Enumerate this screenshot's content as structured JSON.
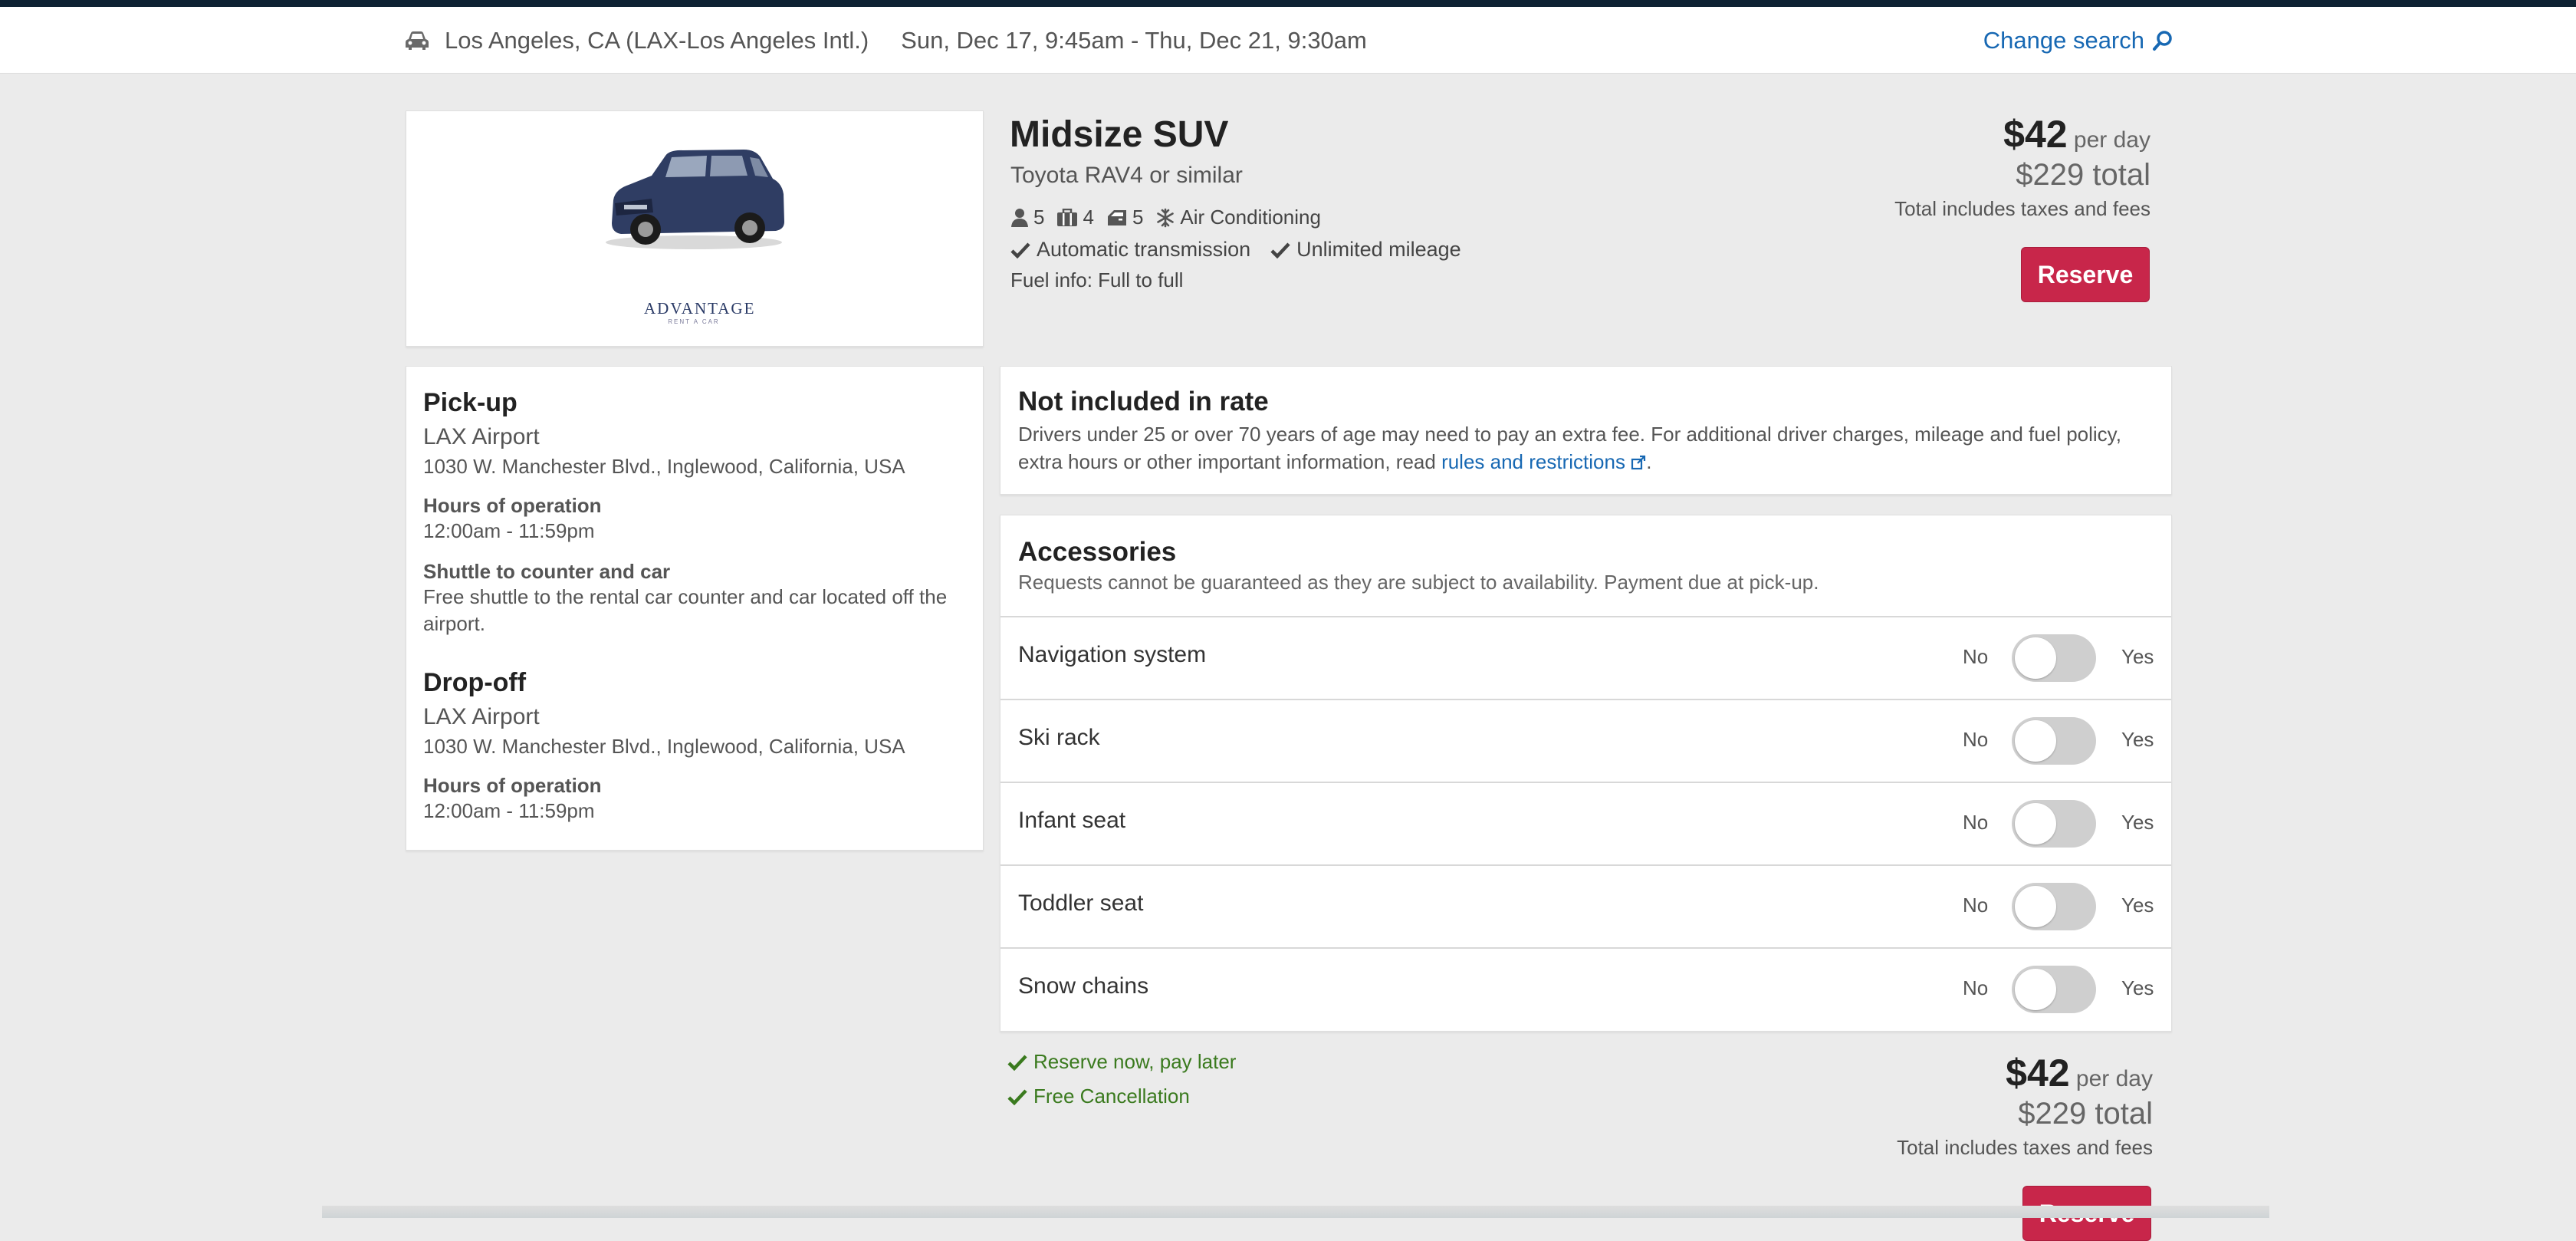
{
  "search": {
    "location": "Los Angeles, CA (LAX-Los Angeles Intl.)",
    "dates": "Sun, Dec 17, 9:45am - Thu, Dec 21, 9:30am",
    "change_label": "Change search"
  },
  "car": {
    "brand_logo": "ADVANTAGE",
    "brand_logo_sub": "RENT A CAR",
    "title": "Midsize SUV",
    "subtitle": "Toyota RAV4 or similar",
    "passengers": "5",
    "bags": "4",
    "doors": "5",
    "ac": "Air Conditioning",
    "transmission": "Automatic transmission",
    "mileage": "Unlimited mileage",
    "fuel": "Fuel info: Full to full"
  },
  "price": {
    "amount": "$42",
    "per": "per day",
    "total": "$229 total",
    "taxes": "Total includes taxes and fees",
    "reserve_label": "Reserve"
  },
  "pickup": {
    "heading": "Pick-up",
    "name": "LAX Airport",
    "address": "1030 W. Manchester Blvd., Inglewood, California, USA",
    "hours_label": "Hours of operation",
    "hours": "12:00am - 11:59pm",
    "shuttle_label": "Shuttle to counter and car",
    "shuttle_line1": "Free shuttle to the rental car counter and car located off the",
    "shuttle_line2": "airport."
  },
  "dropoff": {
    "heading": "Drop-off",
    "name": "LAX Airport",
    "address": "1030 W. Manchester Blvd., Inglewood, California, USA",
    "hours_label": "Hours of operation",
    "hours": "12:00am - 11:59pm"
  },
  "not_included": {
    "title": "Not included in rate",
    "body_line1": "Drivers under 25 or over 70 years of age may need to pay an extra fee. For additional driver charges, mileage and fuel policy,",
    "body_line2": "extra hours or other important information, read",
    "link": "rules and restrictions",
    "period": "."
  },
  "accessories": {
    "title": "Accessories",
    "description": "Requests cannot be guaranteed as they are subject to availability. Payment due at pick-up.",
    "no_label": "No",
    "yes_label": "Yes",
    "items": [
      {
        "label": "Navigation system"
      },
      {
        "label": "Ski rack"
      },
      {
        "label": "Infant seat"
      },
      {
        "label": "Toddler seat"
      },
      {
        "label": "Snow chains"
      }
    ]
  },
  "perks": {
    "pay_later": "Reserve now, pay later",
    "cancellation": "Free Cancellation"
  },
  "colors": {
    "accent": "#c8264a",
    "link": "#1768b3",
    "success": "#3a7a1e",
    "header": "#0e2233"
  }
}
